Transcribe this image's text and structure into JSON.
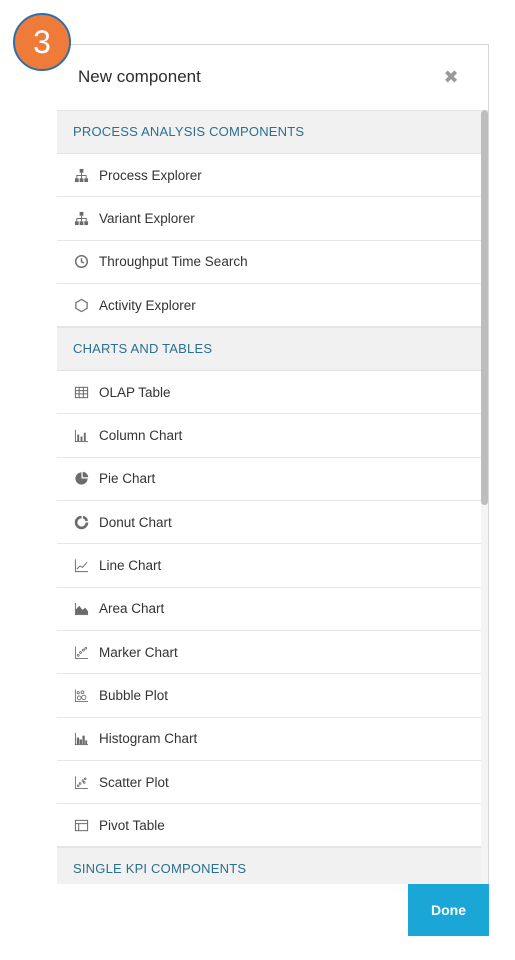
{
  "badge": "3",
  "dialog": {
    "title": "New component",
    "close_icon": "close-icon",
    "done_label": "Done"
  },
  "sections": [
    {
      "title": "PROCESS ANALYSIS COMPONENTS",
      "items": [
        {
          "label": "Process Explorer",
          "icon": "hierarchy-icon"
        },
        {
          "label": "Variant Explorer",
          "icon": "hierarchy-icon"
        },
        {
          "label": "Throughput Time Search",
          "icon": "clock-icon"
        },
        {
          "label": "Activity Explorer",
          "icon": "hexagon-icon"
        }
      ]
    },
    {
      "title": "CHARTS AND TABLES",
      "items": [
        {
          "label": "OLAP Table",
          "icon": "table-icon"
        },
        {
          "label": "Column Chart",
          "icon": "column-chart-icon"
        },
        {
          "label": "Pie Chart",
          "icon": "pie-chart-icon"
        },
        {
          "label": "Donut Chart",
          "icon": "donut-chart-icon"
        },
        {
          "label": "Line Chart",
          "icon": "line-chart-icon"
        },
        {
          "label": "Area Chart",
          "icon": "area-chart-icon"
        },
        {
          "label": "Marker Chart",
          "icon": "marker-chart-icon"
        },
        {
          "label": "Bubble Plot",
          "icon": "bubble-plot-icon"
        },
        {
          "label": "Histogram Chart",
          "icon": "histogram-icon"
        },
        {
          "label": "Scatter Plot",
          "icon": "scatter-plot-icon"
        },
        {
          "label": "Pivot Table",
          "icon": "pivot-table-icon"
        }
      ]
    },
    {
      "title": "SINGLE KPI COMPONENTS",
      "items": []
    }
  ],
  "colors": {
    "accent": "#1aa7d8",
    "section_text": "#2a6f8f",
    "badge": "#ee7b3a"
  }
}
